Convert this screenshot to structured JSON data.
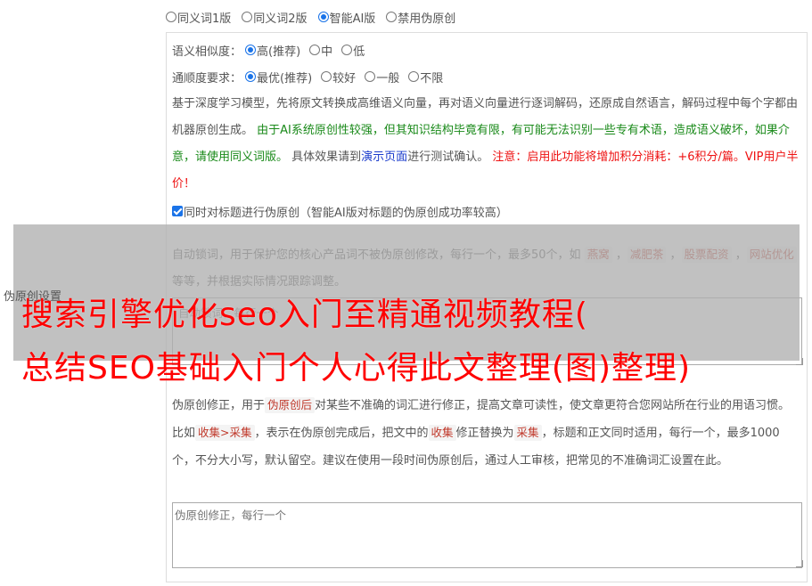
{
  "versions": [
    {
      "label": "同义词1版",
      "selected": false
    },
    {
      "label": "同义词2版",
      "selected": false
    },
    {
      "label": "智能AI版",
      "selected": true
    },
    {
      "label": "禁用伪原创",
      "selected": false
    }
  ],
  "similarity": {
    "label": "语义相似度：",
    "options": [
      {
        "label": "高(推荐)",
        "selected": true
      },
      {
        "label": "中",
        "selected": false
      },
      {
        "label": "低",
        "selected": false
      }
    ]
  },
  "fluency": {
    "label": "通顺度要求：",
    "options": [
      {
        "label": "最优(推荐)",
        "selected": true
      },
      {
        "label": "较好",
        "selected": false
      },
      {
        "label": "一般",
        "selected": false
      },
      {
        "label": "不限",
        "selected": false
      }
    ]
  },
  "ai_description": {
    "part1": "基于深度学习模型，先将原文转换成高维语义向量，再对语义向量进行逐词解码，还原成自然语言，解码过程中每个字都由机器原创生成。",
    "warning_green": "由于AI系统原创性较强，但其知识结构毕竟有限，有可能无法识别一些专有术语，造成语义破坏，如果介意，请使用同义词版。",
    "part2": "具体效果请到",
    "demo_link": "演示页面",
    "part3": "进行测试确认。",
    "notice_red": "注意：启用此功能将增加积分消耗：+6积分/篇。VIP用户半价！"
  },
  "title_checkbox": {
    "label": "同时对标题进行伪原创（智能AI版对标题的伪原创成功率较高）",
    "checked": true
  },
  "lock_words": {
    "desc_before": "自动锁词，用于保护您的核心产品词不被伪原创修改，每行一个，最多50个，如",
    "examples": [
      "燕窝",
      "减肥茶",
      "股票配资",
      "网站优化"
    ],
    "desc_after": "等等，并根据实际情况跟踪调整。",
    "placeholder": "自动锁词，每行一个"
  },
  "side_label": "伪原创设置",
  "overlay_title": {
    "line1": "搜索引擎优化seo入门至精通视频教程(",
    "line2": "总结SEO基础入门个人心得此文整理(图)整理)"
  },
  "correction": {
    "text1": "伪原创修正，用于",
    "tag1": "伪原创后",
    "text2": "对某些不准确的词汇进行修正，提高文章可读性，使文章更符合您网站所在行业的用语习惯。比如",
    "tag2": "收集>采集",
    "text3": "，表示在伪原创完成后，把文中的",
    "tag3": "收集",
    "text4": "修正替换为",
    "tag4": "采集",
    "text5": "，标题和正文同时适用，每行一个，最多1000个，不分大小写，默认留空。建议在使用一段时间伪原创后，通过人工审核，把常见的不准确词汇设置在此。",
    "placeholder": "伪原创修正，每行一个"
  },
  "colors": {
    "accent": "#1a73e8",
    "green_text": "#1a8a1a",
    "link": "#1a3bcc",
    "red": "#ee1111",
    "title_red": "#ff0000"
  }
}
